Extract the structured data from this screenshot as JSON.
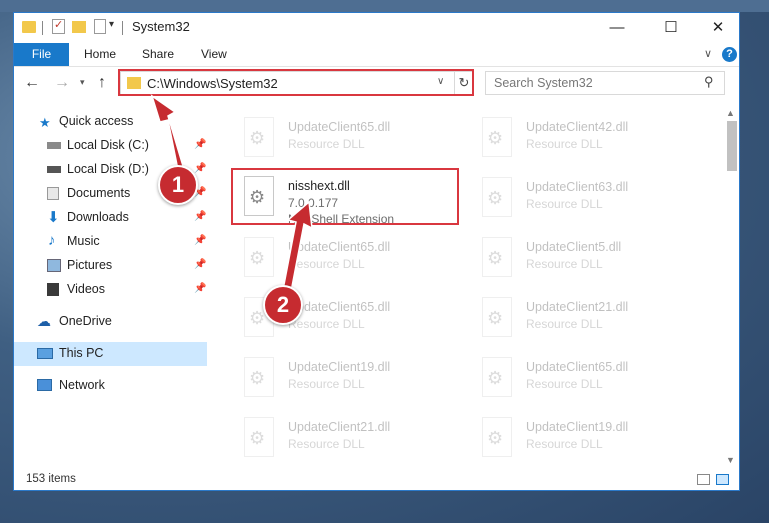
{
  "window": {
    "title": "System32",
    "controls": {
      "minimize": "—",
      "maximize": "☐",
      "close": "✕"
    }
  },
  "ribbon": {
    "file_tab": "File",
    "tabs": [
      "Home",
      "Share",
      "View"
    ],
    "help": "?"
  },
  "address_bar": {
    "path": "C:\\Windows\\System32"
  },
  "search": {
    "placeholder": "Search System32"
  },
  "sidebar": {
    "quick_access": "Quick access",
    "items": [
      {
        "label": "Local Disk (C:)",
        "icon": "drive-icon",
        "pinned": true
      },
      {
        "label": "Local Disk (D:)",
        "icon": "drive-icon",
        "pinned": true
      },
      {
        "label": "Documents",
        "icon": "documents-icon",
        "pinned": true
      },
      {
        "label": "Downloads",
        "icon": "downloads-icon",
        "pinned": true
      },
      {
        "label": "Music",
        "icon": "music-icon",
        "pinned": true
      },
      {
        "label": "Pictures",
        "icon": "pictures-icon",
        "pinned": true
      },
      {
        "label": "Videos",
        "icon": "videos-icon",
        "pinned": true
      }
    ],
    "onedrive": "OneDrive",
    "this_pc": "This PC",
    "network": "Network"
  },
  "files": {
    "focus": {
      "name": "nisshext.dll",
      "version": "7.0.0.177",
      "description": "NIS Shell Extension"
    },
    "faded": [
      {
        "name": "UpdateClient65.dll",
        "description": "Resource DLL"
      },
      {
        "name": "UpdateClient42.dll",
        "description": "Resource DLL"
      },
      {
        "name": "UpdateClient63.dll",
        "description": "Resource DLL"
      },
      {
        "name": "UpdateClient65.dll",
        "description": "Resource DLL"
      },
      {
        "name": "UpdateClient5.dll",
        "description": "Resource DLL"
      },
      {
        "name": "UpdateClient65.dll",
        "description": "Resource DLL"
      },
      {
        "name": "UpdateClient21.dll",
        "description": "Resource DLL"
      },
      {
        "name": "UpdateClient19.dll",
        "description": "Resource DLL"
      },
      {
        "name": "UpdateClient65.dll",
        "description": "Resource DLL"
      },
      {
        "name": "UpdateClient21.dll",
        "description": "Resource DLL"
      },
      {
        "name": "UpdateClient19.dll",
        "description": "Resource DLL"
      }
    ]
  },
  "status": {
    "item_count": "153 items"
  },
  "annotations": {
    "step1": "1",
    "step2": "2",
    "highlight_color": "#d9373f"
  }
}
